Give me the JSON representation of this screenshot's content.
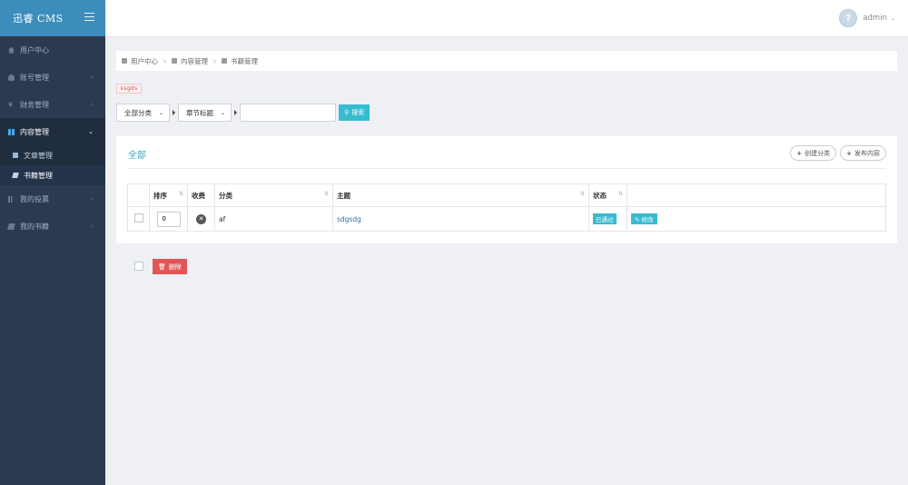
{
  "app": {
    "brand": "迅睿 CMS"
  },
  "sidebar": {
    "items": [
      {
        "label": "用户中心"
      },
      {
        "label": "账号管理"
      },
      {
        "label": "财务管理"
      },
      {
        "label": "内容管理"
      },
      {
        "label": "我的投票"
      },
      {
        "label": "我的书籍"
      }
    ],
    "submenu": [
      {
        "label": "文章管理"
      },
      {
        "label": "书籍管理"
      }
    ]
  },
  "topbar": {
    "username": "admin",
    "avatar_glyph": "?"
  },
  "breadcrumb": [
    "用户中心",
    "内容管理",
    "书籍管理"
  ],
  "tag": "ssgds",
  "filters": {
    "category_select": "全部分类",
    "field_select": "章节标题",
    "search_value": "",
    "search_label": "搜索"
  },
  "panel": {
    "title": "全部",
    "actions": {
      "create_category": "创建分类",
      "publish_content": "发布内容"
    }
  },
  "table": {
    "headers": {
      "order": "排序",
      "fee": "收费",
      "category": "分类",
      "subject": "主题",
      "status": "状态"
    },
    "rows": [
      {
        "order": "0",
        "category": "af",
        "subject": "sdgsdg",
        "status": "已通过",
        "edit": "修改"
      }
    ]
  },
  "bottom": {
    "delete_label": "删除"
  },
  "colors": {
    "accent": "#36bcd0",
    "brand": "#3c8dbc",
    "sidebar": "#2b3a4f",
    "danger": "#e05656"
  }
}
